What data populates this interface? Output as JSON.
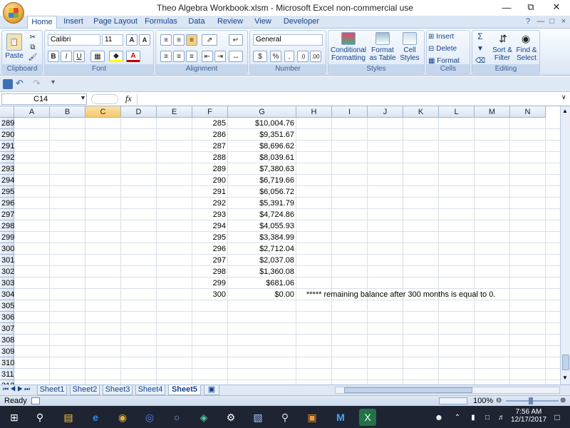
{
  "window": {
    "title": "Theo Algebra Workbook.xlsm - Microsoft Excel non-commercial use"
  },
  "ribbon": {
    "tabs": [
      "Home",
      "Insert",
      "Page Layout",
      "Formulas",
      "Data",
      "Review",
      "View",
      "Developer"
    ],
    "active_tab": "Home",
    "groups": {
      "clipboard": "Clipboard",
      "font": "Font",
      "alignment": "Alignment",
      "number": "Number",
      "styles": "Styles",
      "cells": "Cells",
      "editing": "Editing"
    },
    "paste": "Paste",
    "font_name": "Calibri",
    "font_size": "11",
    "number_format": "General",
    "conditional_formatting": "Conditional\nFormatting",
    "format_as_table": "Format\nas Table",
    "cell_styles": "Cell\nStyles",
    "insert": "Insert",
    "delete": "Delete",
    "format": "Format",
    "sort_filter": "Sort &\nFilter",
    "find_select": "Find &\nSelect",
    "font_color": "#c00000",
    "fill_color": "#ffff00"
  },
  "formula_bar": {
    "name_box": "C14",
    "fx": "fx",
    "formula": ""
  },
  "columns": [
    "A",
    "B",
    "C",
    "D",
    "E",
    "F",
    "G",
    "H",
    "I",
    "J",
    "K",
    "L",
    "M",
    "N"
  ],
  "selected_column": "C",
  "rows": [
    {
      "r": "289",
      "f": "285",
      "g": "$10,004.76"
    },
    {
      "r": "290",
      "f": "286",
      "g": "$9,351.67"
    },
    {
      "r": "291",
      "f": "287",
      "g": "$8,696.62"
    },
    {
      "r": "292",
      "f": "288",
      "g": "$8,039.61"
    },
    {
      "r": "293",
      "f": "289",
      "g": "$7,380.63"
    },
    {
      "r": "294",
      "f": "290",
      "g": "$6,719.66"
    },
    {
      "r": "295",
      "f": "291",
      "g": "$6,056.72"
    },
    {
      "r": "296",
      "f": "292",
      "g": "$5,391.79"
    },
    {
      "r": "297",
      "f": "293",
      "g": "$4,724.86"
    },
    {
      "r": "298",
      "f": "294",
      "g": "$4,055.93"
    },
    {
      "r": "299",
      "f": "295",
      "g": "$3,384.99"
    },
    {
      "r": "300",
      "f": "296",
      "g": "$2,712.04"
    },
    {
      "r": "301",
      "f": "297",
      "g": "$2,037.08"
    },
    {
      "r": "302",
      "f": "298",
      "g": "$1,360.08"
    },
    {
      "r": "303",
      "f": "299",
      "g": "$681.06"
    },
    {
      "r": "304",
      "f": "300",
      "g": "$0.00",
      "h": "***** remaining balance after 300 months is equal to 0."
    },
    {
      "r": "305"
    },
    {
      "r": "306"
    },
    {
      "r": "307"
    },
    {
      "r": "308"
    },
    {
      "r": "309"
    },
    {
      "r": "310"
    },
    {
      "r": "311"
    },
    {
      "r": "312"
    }
  ],
  "sheets": [
    "Sheet1",
    "Sheet2",
    "Sheet3",
    "Sheet4",
    "Sheet5"
  ],
  "active_sheet": "Sheet5",
  "status": {
    "ready": "Ready",
    "zoom": "100%"
  },
  "taskbar": {
    "time": "7:56 AM",
    "date": "12/17/2017"
  }
}
